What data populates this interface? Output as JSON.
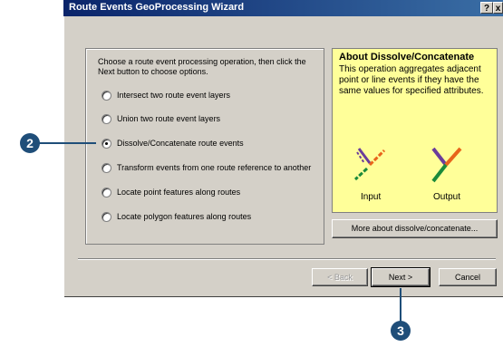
{
  "window": {
    "title": "Route Events GeoProcessing Wizard"
  },
  "title_buttons": {
    "help": "?",
    "close": "x"
  },
  "instructions": "Choose a route event processing operation, then click the Next button to choose options.",
  "options": [
    {
      "label": "Intersect two route event layers",
      "selected": false
    },
    {
      "label": "Union two route event layers",
      "selected": false
    },
    {
      "label": "Dissolve/Concatenate route events",
      "selected": true
    },
    {
      "label": "Transform events from one route reference to another",
      "selected": false
    },
    {
      "label": "Locate point features along routes",
      "selected": false
    },
    {
      "label": "Locate polygon features along routes",
      "selected": false
    }
  ],
  "info": {
    "title": "About Dissolve/Concatenate",
    "text": "This operation aggregates adjacent point or line events if they have the same values for specified attributes.",
    "input_label": "Input",
    "output_label": "Output",
    "colors": {
      "purple": "#6a3d9a",
      "orange": "#e8641b",
      "green": "#1a8a3a"
    }
  },
  "more_button": "More about dissolve/concatenate...",
  "buttons": {
    "back": "< Back",
    "next": "Next >",
    "cancel": "Cancel"
  },
  "callouts": {
    "left": "2",
    "bottom": "3"
  }
}
